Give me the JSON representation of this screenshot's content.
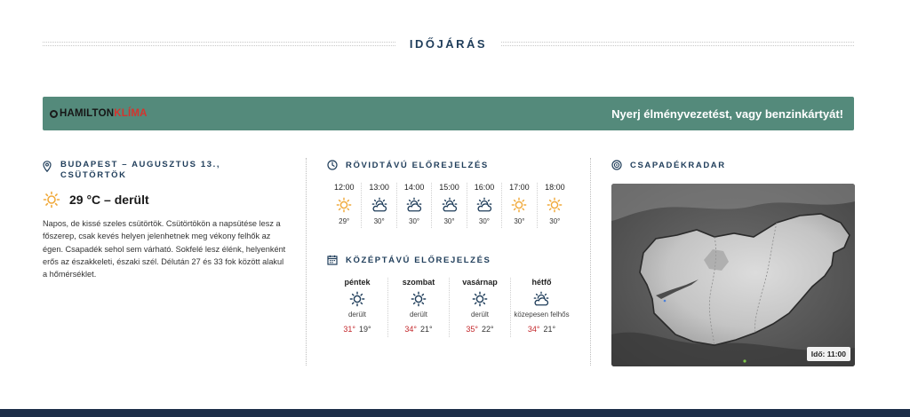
{
  "section": {
    "title": "IDŐJÁRÁS"
  },
  "banner": {
    "brand_part1": "HAMILTON",
    "brand_part2": "KLÍMA",
    "promo": "Nyerj élményvezetést, vagy benzinkártyát!"
  },
  "current": {
    "location": "BUDAPEST – AUGUSZTUS 13., CSÜTÖRTÖK",
    "temp_text": "29 °C – derült",
    "icon": "sun-icon",
    "description": "Napos, de kissé szeles csütörtök. Csütörtökön a napsütése lesz a főszerep, csak kevés helyen jelenhetnek meg vékony felhők az égen. Csapadék sehol sem várható. Sokfelé lesz élénk, helyenként erős az északkeleti, északi szél. Délután 27 és 33 fok között alakul a hőmérséklet."
  },
  "short_forecast": {
    "title": "RÖVIDTÁVÚ ELŐREJELZÉS",
    "hours": [
      {
        "time": "12:00",
        "icon": "sun-icon",
        "temp": "29°"
      },
      {
        "time": "13:00",
        "icon": "partly-cloudy-icon",
        "temp": "30°"
      },
      {
        "time": "14:00",
        "icon": "partly-cloudy-icon",
        "temp": "30°"
      },
      {
        "time": "15:00",
        "icon": "partly-cloudy-icon",
        "temp": "30°"
      },
      {
        "time": "16:00",
        "icon": "partly-cloudy-icon",
        "temp": "30°"
      },
      {
        "time": "17:00",
        "icon": "sun-icon",
        "temp": "30°"
      },
      {
        "time": "18:00",
        "icon": "sun-icon",
        "temp": "30°"
      }
    ]
  },
  "mid_forecast": {
    "title": "KÖZÉPTÁVÚ ELŐREJELZÉS",
    "days": [
      {
        "day": "péntek",
        "icon": "sun-outline-icon",
        "cond": "derült",
        "hi": "31°",
        "lo": "19°"
      },
      {
        "day": "szombat",
        "icon": "sun-outline-icon",
        "cond": "derült",
        "hi": "34°",
        "lo": "21°"
      },
      {
        "day": "vasárnap",
        "icon": "sun-outline-icon",
        "cond": "derült",
        "hi": "35°",
        "lo": "22°"
      },
      {
        "day": "hétfő",
        "icon": "partly-cloudy-icon",
        "cond": "közepesen felhős",
        "hi": "34°",
        "lo": "21°"
      }
    ]
  },
  "radar": {
    "title": "CSAPADÉKRADAR",
    "time_label": "Idő: 11:00"
  },
  "colors": {
    "banner_bg": "#548a7b",
    "heading": "#1f3d5a",
    "sun": "#f0a93a",
    "hi_temp": "#c3272b",
    "footer": "#1c2d48"
  }
}
